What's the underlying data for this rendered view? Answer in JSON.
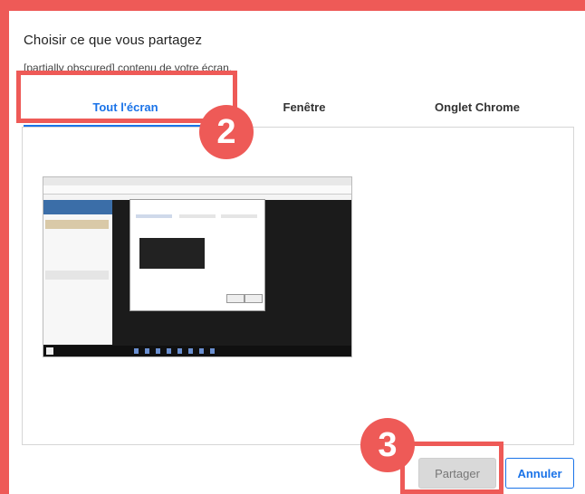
{
  "dialog": {
    "title": "Choisir ce que vous partagez",
    "subtitle": "[partially obscured] contenu de votre écran."
  },
  "tabs": [
    {
      "label": "Tout l'écran",
      "active": true
    },
    {
      "label": "Fenêtre",
      "active": false
    },
    {
      "label": "Onglet Chrome",
      "active": false
    }
  ],
  "annotations": {
    "step_tabs": "2",
    "step_share": "3",
    "color": "#ee5a57"
  },
  "buttons": {
    "share_label": "Partager",
    "cancel_label": "Annuler"
  },
  "colors": {
    "accent": "#1a73e8",
    "highlight": "#ee5a57"
  }
}
